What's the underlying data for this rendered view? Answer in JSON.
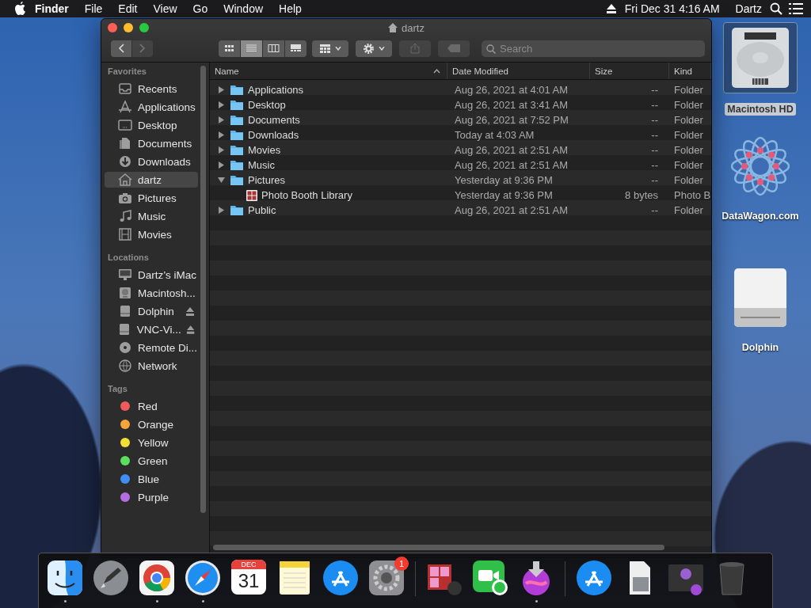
{
  "menubar": {
    "app": "Finder",
    "menus": [
      "File",
      "Edit",
      "View",
      "Go",
      "Window",
      "Help"
    ],
    "clock": "Fri Dec 31  4:16 AM",
    "user": "Dartz"
  },
  "window": {
    "title": "dartz",
    "view_modes": [
      {
        "selected": false
      },
      {
        "selected": true
      },
      {
        "selected": false
      },
      {
        "selected": false
      }
    ],
    "share_disabled": true,
    "tag_disabled": true,
    "search": {
      "placeholder": "Search"
    }
  },
  "sidebar": [
    {
      "heading": "Favorites",
      "items": [
        {
          "label": "Recents",
          "selected": false
        },
        {
          "label": "Applications",
          "selected": false
        },
        {
          "label": "Desktop",
          "selected": false
        },
        {
          "label": "Documents",
          "selected": false
        },
        {
          "label": "Downloads",
          "selected": false
        },
        {
          "label": "dartz",
          "selected": true
        },
        {
          "label": "Pictures",
          "selected": false
        },
        {
          "label": "Music",
          "selected": false
        },
        {
          "label": "Movies",
          "selected": false
        }
      ]
    },
    {
      "heading": "Locations",
      "items": [
        {
          "label": "Dartz’s iMac",
          "selected": false,
          "ejectable": false
        },
        {
          "label": "Macintosh...",
          "selected": false,
          "ejectable": false
        },
        {
          "label": "Dolphin",
          "selected": false,
          "ejectable": true
        },
        {
          "label": "VNC-Vi...",
          "selected": false,
          "ejectable": true
        },
        {
          "label": "Remote Di...",
          "selected": false,
          "ejectable": false
        },
        {
          "label": "Network",
          "selected": false,
          "ejectable": false
        }
      ]
    },
    {
      "heading": "Tags",
      "items": [
        {
          "label": "Red",
          "selected": false,
          "color": "#f05a5a"
        },
        {
          "label": "Orange",
          "selected": false,
          "color": "#f5a33b"
        },
        {
          "label": "Yellow",
          "selected": false,
          "color": "#f2de35"
        },
        {
          "label": "Green",
          "selected": false,
          "color": "#5ae05a"
        },
        {
          "label": "Blue",
          "selected": false,
          "color": "#3f8ef5"
        },
        {
          "label": "Purple",
          "selected": false,
          "color": "#b56ee0"
        }
      ]
    }
  ],
  "table": {
    "columns": [
      "Name",
      "Date Modified",
      "Size",
      "Kind"
    ],
    "rows": [
      {
        "name": "Applications",
        "date": "Aug 26, 2021 at 4:01 AM",
        "size": "--",
        "kind": "Folder",
        "expanded": false
      },
      {
        "name": "Desktop",
        "date": "Aug 26, 2021 at 3:41 AM",
        "size": "--",
        "kind": "Folder",
        "expanded": false
      },
      {
        "name": "Documents",
        "date": "Aug 26, 2021 at 7:52 PM",
        "size": "--",
        "kind": "Folder",
        "expanded": false
      },
      {
        "name": "Downloads",
        "date": "Today at 4:03 AM",
        "size": "--",
        "kind": "Folder",
        "expanded": false
      },
      {
        "name": "Movies",
        "date": "Aug 26, 2021 at 2:51 AM",
        "size": "--",
        "kind": "Folder",
        "expanded": false
      },
      {
        "name": "Music",
        "date": "Aug 26, 2021 at 2:51 AM",
        "size": "--",
        "kind": "Folder",
        "expanded": false
      },
      {
        "name": "Pictures",
        "date": "Yesterday at 9:36 PM",
        "size": "--",
        "kind": "Folder",
        "expanded": true,
        "children": [
          {
            "name": "Photo Booth Library",
            "date": "Yesterday at 9:36 PM",
            "size": "8 bytes",
            "kind": "Photo B"
          }
        ]
      },
      {
        "name": "Public",
        "date": "Aug 26, 2021 at 2:51 AM",
        "size": "--",
        "kind": "Folder",
        "expanded": false
      }
    ]
  },
  "desktop_icons": [
    {
      "label": "Macintosh HD",
      "selected": true
    },
    {
      "label": "DataWagon.com",
      "selected": false
    },
    {
      "label": "Dolphin",
      "selected": false
    }
  ],
  "dock": [
    {
      "running": true
    },
    {
      "running": false
    },
    {
      "running": true
    },
    {
      "running": true
    },
    {
      "running": false,
      "month": "DEC",
      "day": "31"
    },
    {
      "running": false
    },
    {
      "running": false
    },
    {
      "running": false,
      "badge": "1"
    },
    {
      "running": false
    },
    {
      "running": false
    },
    {
      "running": true
    },
    {
      "running": false
    },
    {
      "running": false
    },
    {
      "running": false
    },
    {
      "running": false
    }
  ]
}
